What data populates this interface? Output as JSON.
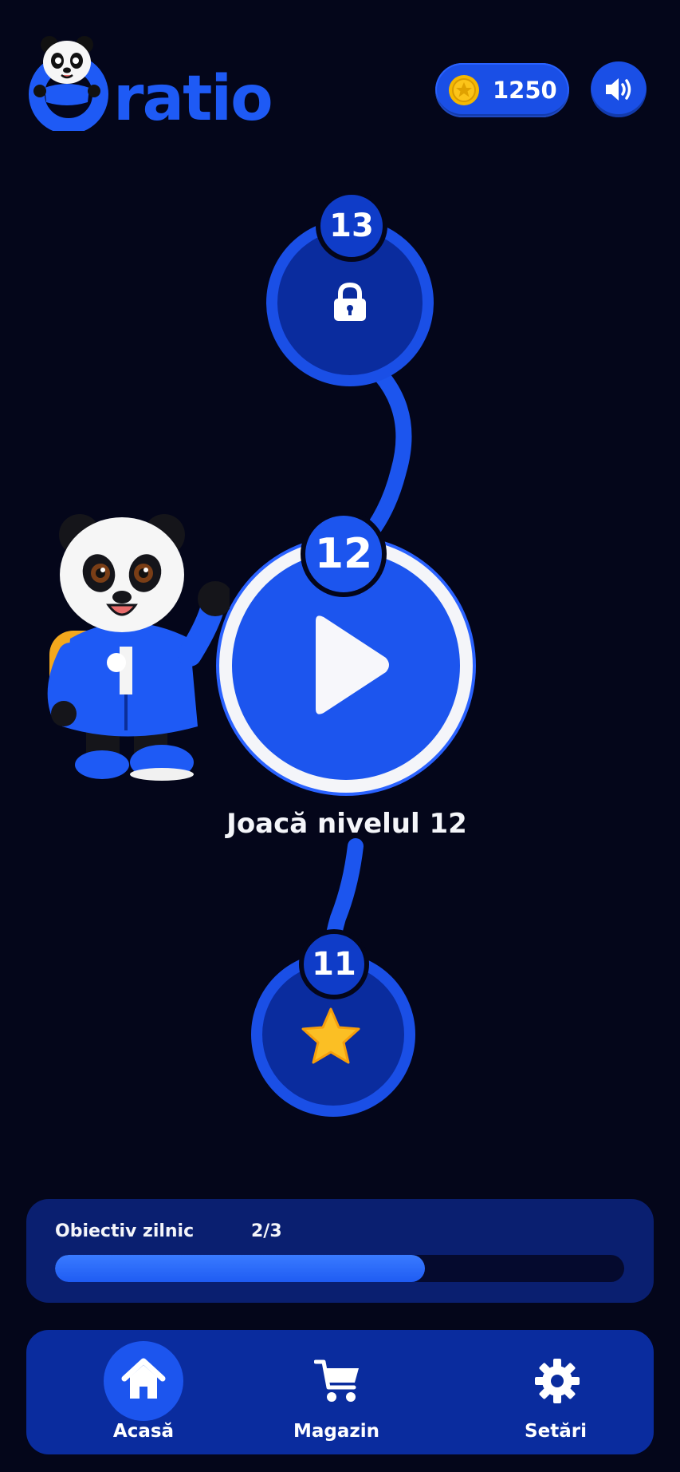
{
  "app": {
    "logo_text": "ratio"
  },
  "header": {
    "coins": "1250",
    "coin_icon": "gold-coin-icon",
    "sound_icon": "speaker-volume-icon"
  },
  "levels": [
    {
      "number": "13",
      "state": "locked",
      "icon": "lock-icon"
    },
    {
      "number": "12",
      "state": "current",
      "icon": "play-icon"
    },
    {
      "number": "11",
      "state": "completed",
      "icon": "star-icon"
    }
  ],
  "play": {
    "caption": "Joacă nivelul 12"
  },
  "daily_goal": {
    "label": "Obiectiv zilnic",
    "progress_text": "2/3",
    "fill_fraction": 0.65
  },
  "nav": {
    "items": [
      {
        "label": "Acasă",
        "icon": "home-icon",
        "active": true
      },
      {
        "label": "Magazin",
        "icon": "shopping-cart-icon",
        "active": false
      },
      {
        "label": "Setări",
        "icon": "gear-icon",
        "active": false
      }
    ]
  },
  "colors": {
    "background": "#04061a",
    "accent": "#1c55ee",
    "star": "#fbbf24",
    "coin": "#f5b800"
  }
}
